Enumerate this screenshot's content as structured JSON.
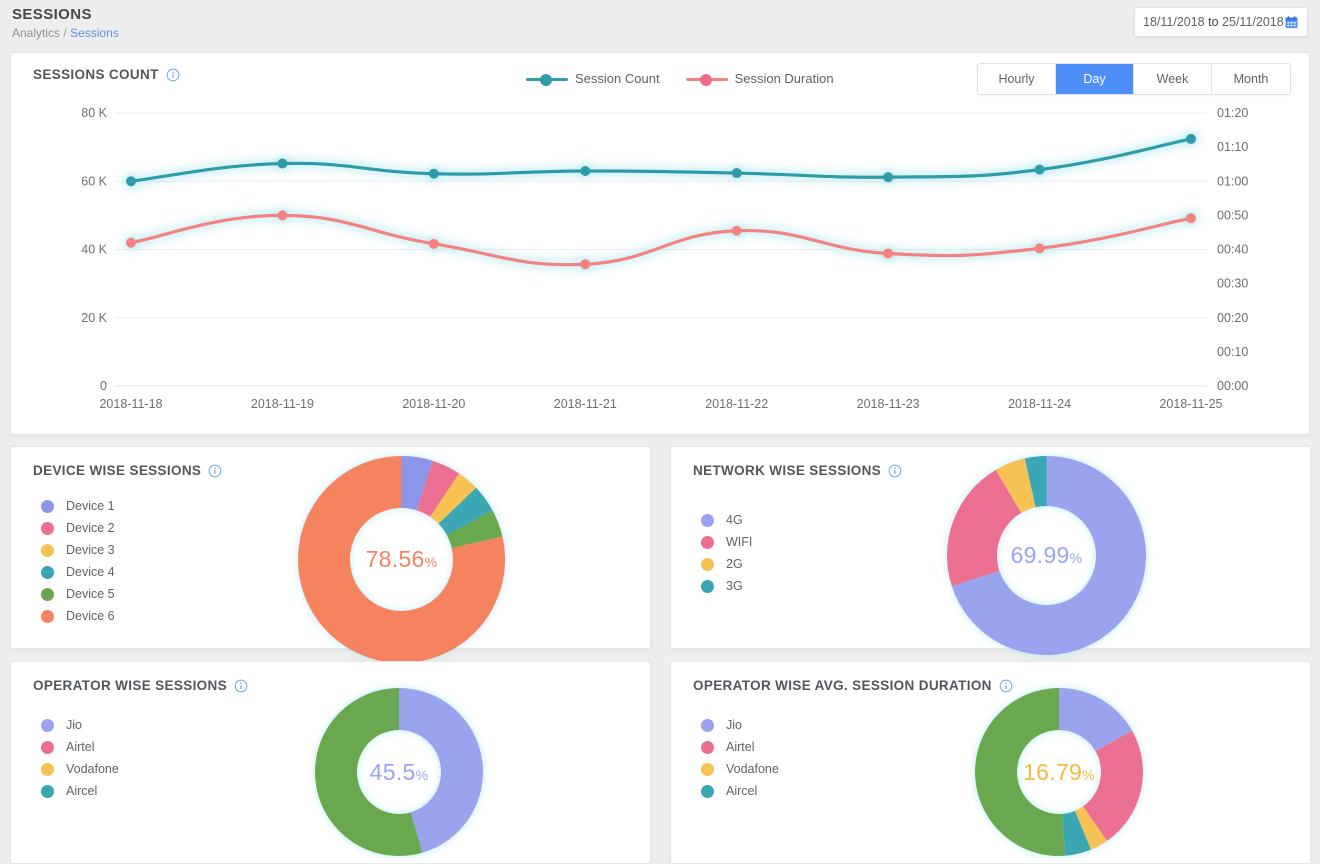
{
  "header": {
    "title": "SESSIONS",
    "breadcrumb_root": "Analytics",
    "breadcrumb_sep": "/",
    "breadcrumb_current": "Sessions",
    "daterange_start": "18/11/2018",
    "daterange_joiner": "to",
    "daterange_end": "25/11/2018",
    "calendar_icon": "calendar-icon",
    "accent_blue": "#4e8ef7"
  },
  "sessions_panel": {
    "title": "SESSIONS COUNT",
    "info_icon": "info-icon",
    "periods": [
      {
        "label": "Hourly",
        "active": false
      },
      {
        "label": "Day",
        "active": true
      },
      {
        "label": "Week",
        "active": false
      },
      {
        "label": "Month",
        "active": false
      }
    ]
  },
  "chart_data": [
    {
      "id": "sessions-count-line",
      "type": "line",
      "title": "SESSIONS COUNT",
      "xlabel": "",
      "ylabel": "",
      "grid": true,
      "legend_position": "top-center",
      "x": [
        "2018-11-18",
        "2018-11-19",
        "2018-11-20",
        "2018-11-21",
        "2018-11-22",
        "2018-11-23",
        "2018-11-24",
        "2018-11-25"
      ],
      "y_left": {
        "label": "Session Count",
        "ticks": [
          "0",
          "20 K",
          "40 K",
          "60 K",
          "80 K"
        ],
        "tick_values": [
          0,
          20000,
          40000,
          60000,
          80000
        ],
        "ylim": [
          0,
          80000
        ]
      },
      "y_right": {
        "label": "Session Duration",
        "ticks": [
          "00:00",
          "00:10",
          "00:20",
          "00:30",
          "00:40",
          "00:50",
          "01:00",
          "01:10",
          "01:20"
        ],
        "tick_seconds": [
          0,
          600,
          1200,
          1800,
          2400,
          3000,
          3600,
          4200,
          4800
        ],
        "ylim_seconds": [
          0,
          4800
        ]
      },
      "series": [
        {
          "name": "Session Count",
          "axis": "left",
          "color": "#2f9bab",
          "values": [
            60000,
            65200,
            62200,
            63000,
            62400,
            61200,
            63400,
            72400
          ]
        },
        {
          "name": "Session Duration",
          "axis": "right",
          "color": "#f4827f",
          "values_seconds": [
            2520,
            3000,
            2500,
            2140,
            2730,
            2330,
            2420,
            2950
          ],
          "values_label": [
            "00:42",
            "00:50",
            "00:42",
            "00:36",
            "00:46",
            "00:39",
            "00:40",
            "00:49"
          ]
        }
      ]
    },
    {
      "id": "device-wise-sessions",
      "type": "pie",
      "title": "DEVICE WISE SESSIONS",
      "center_value": "78.56",
      "center_unit": "%",
      "center_color": "#f5835f",
      "labels": [
        "Device 1",
        "Device 2",
        "Device 3",
        "Device 4",
        "Device 5",
        "Device 6"
      ],
      "colors": [
        "#8b96e9",
        "#ec6f92",
        "#f6c252",
        "#3aa6b4",
        "#6aa84f",
        "#f5835f"
      ],
      "values": [
        4.8,
        4.6,
        3.4,
        4.3,
        4.34,
        78.56
      ]
    },
    {
      "id": "network-wise-sessions",
      "type": "pie",
      "title": "NETWORK WISE SESSIONS",
      "center_value": "69.99",
      "center_unit": "%",
      "center_color": "#9aa4ee",
      "labels": [
        "4G",
        "WIFI",
        "2G",
        "3G"
      ],
      "colors": [
        "#9aa4ee",
        "#ec6f92",
        "#f6c252",
        "#3aa6b4"
      ],
      "values": [
        69.99,
        21.5,
        5.0,
        3.51
      ]
    },
    {
      "id": "operator-wise-sessions",
      "type": "pie",
      "title": "OPERATOR WISE SESSIONS",
      "center_value": "45.5",
      "center_unit": "%",
      "center_color": "#9aa4ee",
      "labels": [
        "Jio",
        "Airtel",
        "Vodafone",
        "Aircel"
      ],
      "colors": [
        "#9aa4ee",
        "#ec6f92",
        "#f6c252",
        "#3aa6b4"
      ],
      "values": [
        45.5,
        0,
        0,
        0
      ],
      "extra_color": "#6aa84f",
      "extra_value": 54.5
    },
    {
      "id": "operator-wise-avg-session-duration",
      "type": "pie",
      "title": "OPERATOR WISE AVG. SESSION DURATION",
      "center_value": "16.79",
      "center_unit": "%",
      "center_color": "#f6b940",
      "labels": [
        "Jio",
        "Airtel",
        "Vodafone",
        "Aircel"
      ],
      "colors": [
        "#9aa4ee",
        "#ec6f92",
        "#f6c252",
        "#3aa6b4"
      ],
      "values": [
        16.79,
        23.5,
        3.5,
        5.0
      ],
      "extra_color": "#6aa84f",
      "extra_value": 51.21
    }
  ],
  "device_panel": {
    "title": "DEVICE WISE SESSIONS",
    "info_icon": "info-icon",
    "legend": [
      {
        "label": "Device 1",
        "color": "#8b96e9"
      },
      {
        "label": "Device 2",
        "color": "#ec6f92"
      },
      {
        "label": "Device 3",
        "color": "#f6c252"
      },
      {
        "label": "Device 4",
        "color": "#3aa6b4"
      },
      {
        "label": "Device 5",
        "color": "#6aa84f"
      },
      {
        "label": "Device 6",
        "color": "#f5835f"
      }
    ],
    "center_value": "78.56",
    "center_unit": "%"
  },
  "network_panel": {
    "title": "NETWORK WISE SESSIONS",
    "info_icon": "info-icon",
    "legend": [
      {
        "label": "4G",
        "color": "#9aa4ee"
      },
      {
        "label": "WIFI",
        "color": "#ec6f92"
      },
      {
        "label": "2G",
        "color": "#f6c252"
      },
      {
        "label": "3G",
        "color": "#3aa6b4"
      }
    ],
    "center_value": "69.99",
    "center_unit": "%"
  },
  "operator_panel": {
    "title": "OPERATOR WISE SESSIONS",
    "info_icon": "info-icon",
    "legend": [
      {
        "label": "Jio",
        "color": "#9aa4ee"
      },
      {
        "label": "Airtel",
        "color": "#ec6f92"
      },
      {
        "label": "Vodafone",
        "color": "#f6c252"
      },
      {
        "label": "Aircel",
        "color": "#3aa6b4"
      }
    ],
    "center_value": "45.5",
    "center_unit": "%"
  },
  "opdur_panel": {
    "title": "OPERATOR WISE AVG. SESSION DURATION",
    "info_icon": "info-icon",
    "legend": [
      {
        "label": "Jio",
        "color": "#9aa4ee"
      },
      {
        "label": "Airtel",
        "color": "#ec6f92"
      },
      {
        "label": "Vodafone",
        "color": "#f6c252"
      },
      {
        "label": "Aircel",
        "color": "#3aa6b4"
      }
    ],
    "center_value": "16.79",
    "center_unit": "%"
  }
}
